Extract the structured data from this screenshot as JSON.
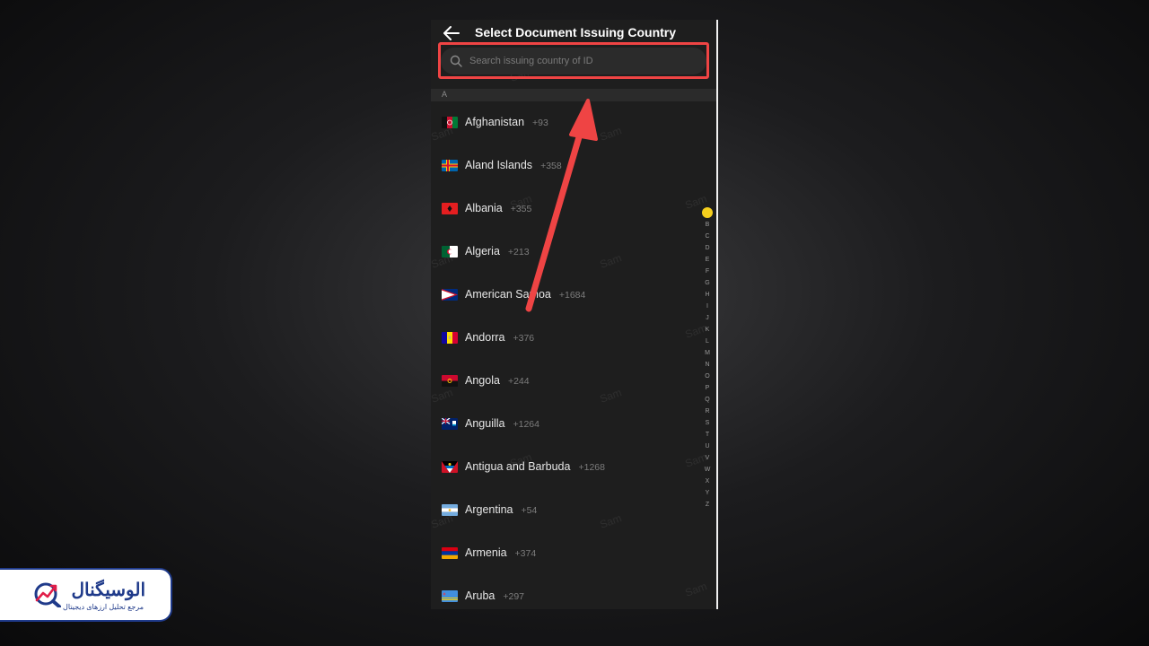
{
  "header": {
    "title": "Select Document Issuing Country",
    "back_icon": "arrow-left-icon"
  },
  "search": {
    "placeholder": "Search issuing country of ID",
    "value": "",
    "icon": "search-icon"
  },
  "section": {
    "letter": "A"
  },
  "countries": [
    {
      "name": "Afghanistan",
      "code": "+93"
    },
    {
      "name": "Aland Islands",
      "code": "+358"
    },
    {
      "name": "Albania",
      "code": "+355"
    },
    {
      "name": "Algeria",
      "code": "+213"
    },
    {
      "name": "American Samoa",
      "code": "+1684"
    },
    {
      "name": "Andorra",
      "code": "+376"
    },
    {
      "name": "Angola",
      "code": "+244"
    },
    {
      "name": "Anguilla",
      "code": "+1264"
    },
    {
      "name": "Antigua and Barbuda",
      "code": "+1268"
    },
    {
      "name": "Argentina",
      "code": "+54"
    },
    {
      "name": "Armenia",
      "code": "+374"
    },
    {
      "name": "Aruba",
      "code": "+297"
    }
  ],
  "alphabet_index": [
    "A",
    "B",
    "C",
    "D",
    "E",
    "F",
    "G",
    "H",
    "I",
    "J",
    "K",
    "L",
    "M",
    "N",
    "O",
    "P",
    "Q",
    "R",
    "S",
    "T",
    "U",
    "V",
    "W",
    "X",
    "Y",
    "Z"
  ],
  "active_letter": "A",
  "watermark_text": "Sam",
  "brand": {
    "name": "الوسیگنال",
    "tagline": "مرجع تحلیل ارزهای دیجیتال"
  },
  "colors": {
    "accent_yellow": "#f5cf1d",
    "highlight_red": "#ef4444",
    "brand_blue": "#1f3a8a",
    "brand_red": "#e11d48"
  }
}
